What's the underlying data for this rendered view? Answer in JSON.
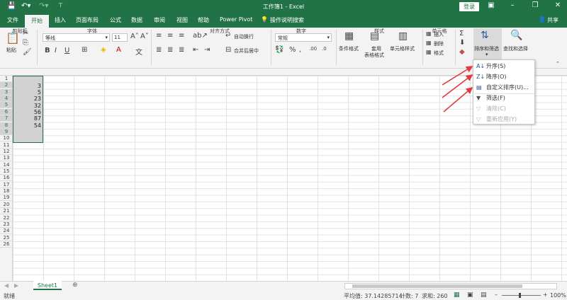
{
  "title": "工作簿1  -  Excel",
  "login_label": "登录",
  "share_label": "共享",
  "tabs": [
    "文件",
    "开始",
    "插入",
    "页面布局",
    "公式",
    "数据",
    "审阅",
    "视图",
    "帮助",
    "Power Pivot"
  ],
  "tell_me": "操作说明搜索",
  "ribbon": {
    "paste": "粘贴",
    "clipboard": "剪贴板",
    "font_name": "等线",
    "font_size": "11",
    "font_group": "字体",
    "wrap_text": "自动换行",
    "merge_center": "合并后居中",
    "align_group": "对齐方式",
    "number_format": "常规",
    "number_group": "数字",
    "cond_format": "条件格式",
    "table_format_1": "套用",
    "table_format_2": "表格格式",
    "cell_styles": "单元格样式",
    "styles_group": "样式",
    "insert": "插入",
    "delete": "删除",
    "format": "格式",
    "cells_group": "单元格",
    "sort_filter": "排序和筛选",
    "find_select": "查找和选择",
    "bold": "B",
    "italic": "I",
    "underline": "U"
  },
  "columns": [],
  "rows": [
    "1",
    "2",
    "3",
    "4",
    "5",
    "6",
    "7",
    "8",
    "9",
    "10",
    "11",
    "12",
    "13",
    "14",
    "15",
    "16",
    "17",
    "18",
    "19",
    "20",
    "21",
    "22",
    "23",
    "24",
    "25",
    "26"
  ],
  "cells": [
    "3",
    "5",
    "23",
    "32",
    "56",
    "87",
    "54"
  ],
  "menu": [
    {
      "label": "升序(S)",
      "icon": "A↓",
      "disabled": false
    },
    {
      "label": "降序(O)",
      "icon": "Z↓",
      "disabled": false
    },
    {
      "label": "自定义排序(U)...",
      "icon": "▤",
      "disabled": false
    },
    {
      "label": "筛选(F)",
      "icon": "▼",
      "disabled": false
    },
    {
      "label": "清除(C)",
      "icon": "▽",
      "disabled": true
    },
    {
      "label": "重新应用(Y)",
      "icon": "▽",
      "disabled": true
    }
  ],
  "sheet_tab": "Sheet1",
  "status": {
    "ready": "就绪",
    "average": "平均值: 37.14285714",
    "count": "计数: 7",
    "sum": "求和: 260",
    "zoom": "100%"
  },
  "colors": {
    "brand": "#217346",
    "arrow": "#e0393e"
  }
}
